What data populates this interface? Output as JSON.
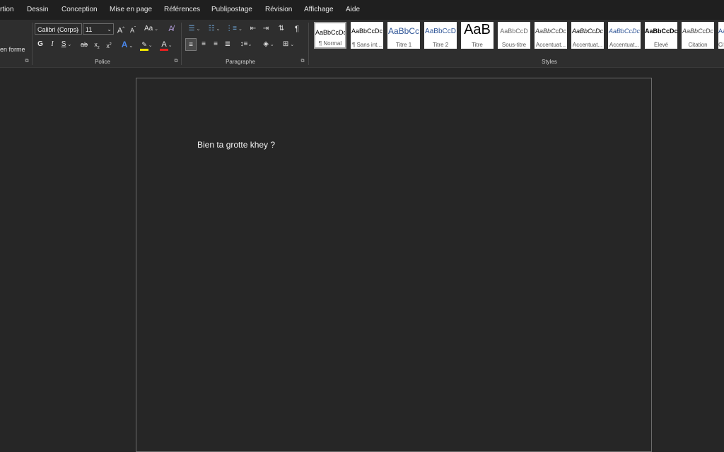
{
  "tabs": [
    "rtion",
    "Dessin",
    "Conception",
    "Mise en page",
    "Références",
    "Publipostage",
    "Révision",
    "Affichage",
    "Aide"
  ],
  "ribbon": {
    "clipboard": {
      "format_painter_partial": "en forme"
    },
    "font": {
      "label": "Police",
      "font_name": "Calibri (Corps)",
      "font_size": "11",
      "bold": "G",
      "italic": "I",
      "underline": "S",
      "strikethrough": "ab",
      "subscript": "x",
      "superscript": "x",
      "grow": "A",
      "shrink": "A",
      "case": "Aa",
      "text_effects": "A",
      "highlight": "ab",
      "font_color": "A",
      "highlight_color": "#f0e600",
      "font_color_value": "#e62020"
    },
    "paragraph": {
      "label": "Paragraphe",
      "pilcrow": "¶"
    },
    "styles": {
      "label": "Styles",
      "items": [
        {
          "sample": "AaBbCcDc",
          "name": "¶ Normal"
        },
        {
          "sample": "AaBbCcDc",
          "name": "¶ Sans int..."
        },
        {
          "sample": "AaBbCc",
          "name": "Titre 1"
        },
        {
          "sample": "AaBbCcD",
          "name": "Titre 2"
        },
        {
          "sample": "AaB",
          "name": "Titre"
        },
        {
          "sample": "AaBbCcD",
          "name": "Sous-titre"
        },
        {
          "sample": "AaBbCcDc",
          "name": "Accentuat..."
        },
        {
          "sample": "AaBbCcDc",
          "name": "Accentuat..."
        },
        {
          "sample": "AaBbCcDc",
          "name": "Accentuat..."
        },
        {
          "sample": "AaBbCcDc",
          "name": "Élevé"
        },
        {
          "sample": "AaBbCcDc",
          "name": "Citation"
        },
        {
          "sample": "AaBbCcDc",
          "name": "Cit"
        }
      ]
    }
  },
  "document": {
    "text": "Bien ta grotte khey ?"
  }
}
